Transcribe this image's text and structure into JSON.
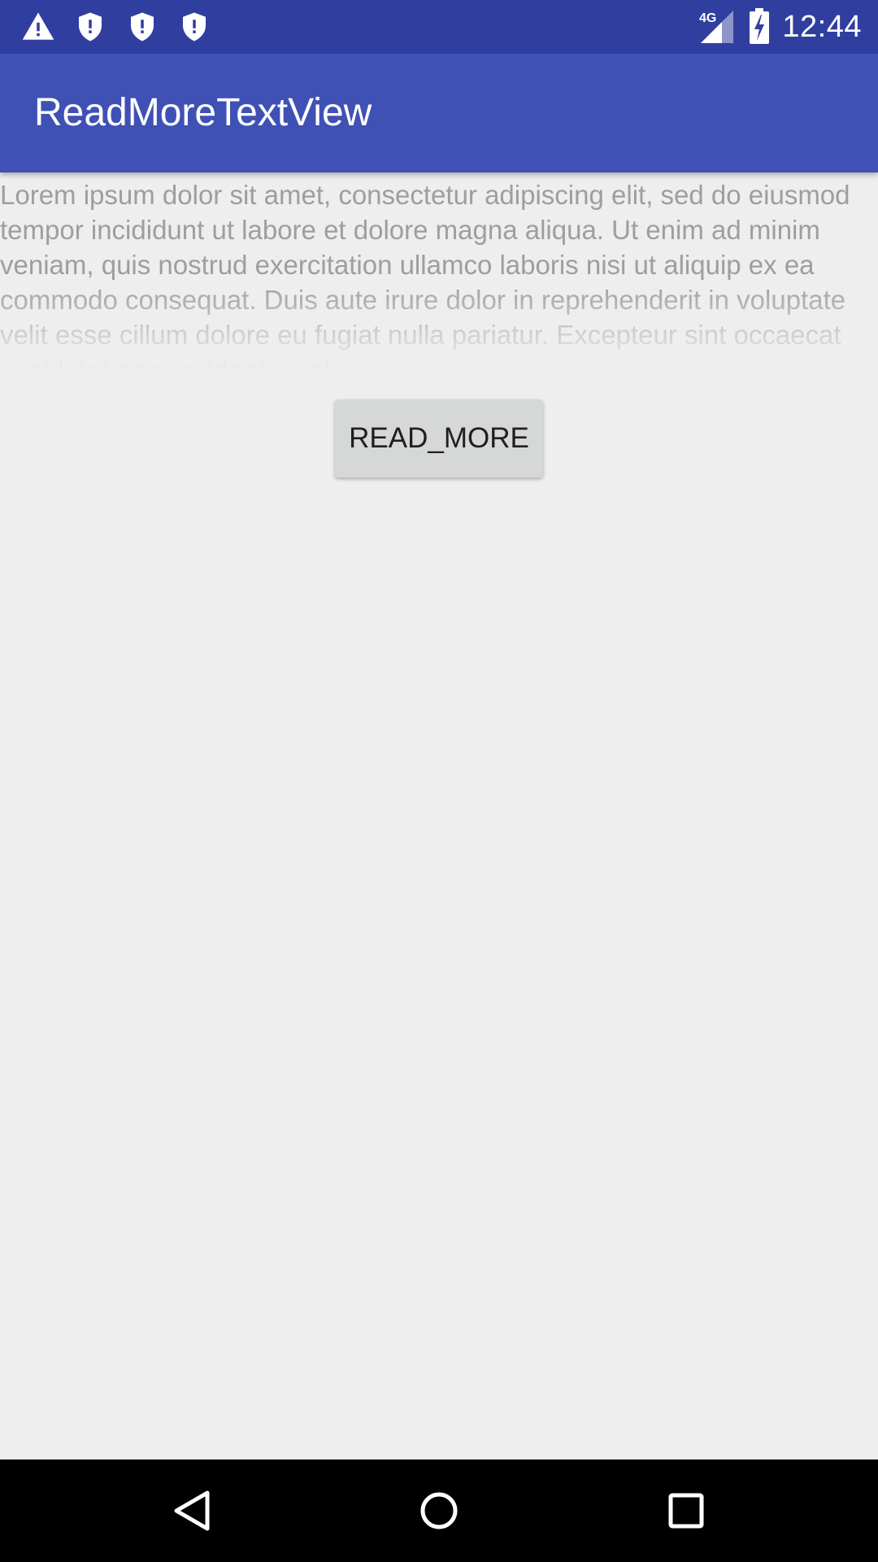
{
  "status_bar": {
    "time": "12:44",
    "network_label": "4G",
    "notification_icons": [
      "warning-icon",
      "shield-icon",
      "shield-icon",
      "shield-icon"
    ],
    "right_icons": [
      "signal-icon",
      "battery-charging-icon"
    ]
  },
  "app_bar": {
    "title": "ReadMoreTextView"
  },
  "content": {
    "text": "Lorem ipsum dolor sit amet, consectetur adipiscing elit, sed do eiusmod tempor incididunt ut labore et dolore magna aliqua. Ut enim ad minim veniam, quis nostrud exercitation ullamco laboris nisi ut aliquip ex ea commodo consequat. Duis aute irure dolor in reprehenderit in voluptate velit esse cillum dolore eu fugiat nulla pariatur. Excepteur sint occaecat cupidatat non proident, sunt in",
    "button_label": "READ_MORE"
  },
  "nav_bar": {
    "buttons": [
      "back-icon",
      "home-icon",
      "recents-icon"
    ]
  },
  "colors": {
    "status_bar": "#303f9f",
    "app_bar": "#3f51b5",
    "background": "#eeeeee",
    "body_text": "#9e9e9e",
    "button_bg": "#d6d7d7"
  }
}
